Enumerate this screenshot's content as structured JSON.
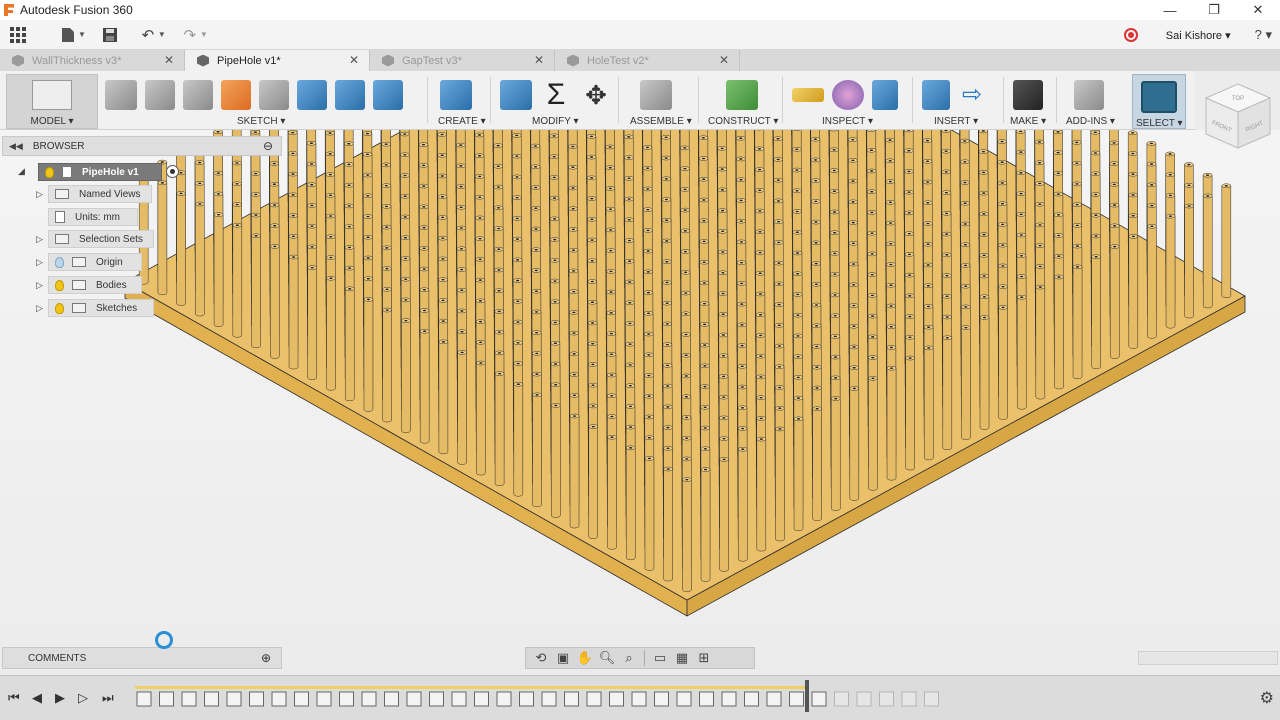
{
  "window": {
    "title": "Autodesk Fusion 360",
    "controls": [
      "—",
      "❐",
      "✕"
    ]
  },
  "qab": {
    "user": "Sai Kishore ▾",
    "help": "? ▾"
  },
  "tabs": [
    {
      "label": "WallThickness v3*",
      "active": false
    },
    {
      "label": "PipeHole v1*",
      "active": true
    },
    {
      "label": "GapTest v3*",
      "active": false
    },
    {
      "label": "HoleTest v2*",
      "active": false
    }
  ],
  "toolbar": {
    "workspace": "MODEL ▾",
    "groups": {
      "sketch": "SKETCH ▾",
      "create": "CREATE ▾",
      "modify": "MODIFY ▾",
      "assemble": "ASSEMBLE ▾",
      "construct": "CONSTRUCT ▾",
      "inspect": "INSPECT ▾",
      "insert": "INSERT ▾",
      "make": "MAKE ▾",
      "addins": "ADD-INS ▾",
      "select": "SELECT ▾"
    }
  },
  "viewcube": {
    "top": "TOP",
    "front": "FRONT",
    "right": "RIGHT"
  },
  "browser": {
    "title": "BROWSER",
    "root": "PipeHole v1",
    "items": [
      {
        "label": "Named Views"
      },
      {
        "label": "Units: mm"
      },
      {
        "label": "Selection Sets"
      },
      {
        "label": "Origin"
      },
      {
        "label": "Bodies"
      },
      {
        "label": "Sketches"
      }
    ]
  },
  "comments": {
    "title": "COMMENTS"
  },
  "colors": {
    "plate_top": "#eac06a",
    "plate_front": "#e1b04f",
    "plate_side": "#d7a645",
    "pin": "#e5bb65",
    "edge": "#2e2e2e"
  }
}
